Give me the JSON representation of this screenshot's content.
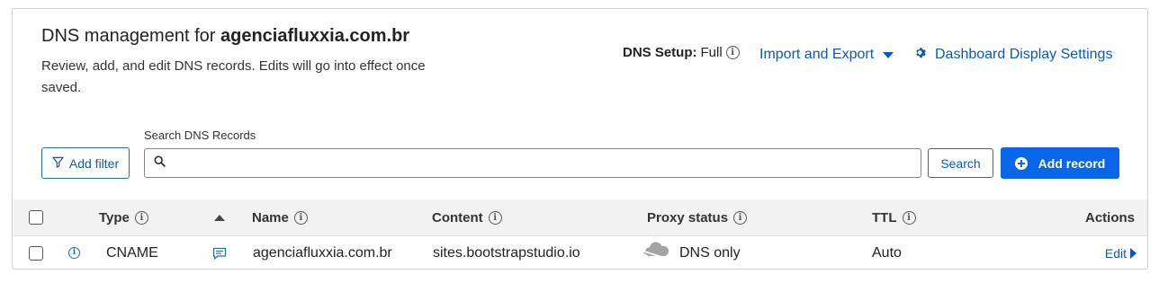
{
  "header": {
    "title_prefix": "DNS management for ",
    "domain": "agenciafluxxia.com.br",
    "subtitle": "Review, add, and edit DNS records. Edits will go into effect once saved.",
    "dns_setup_label": "DNS Setup:",
    "dns_setup_value": "Full",
    "import_export": "Import and Export",
    "dashboard_settings": "Dashboard Display Settings"
  },
  "toolbar": {
    "add_filter": "Add filter",
    "search_label": "Search DNS Records",
    "search_placeholder": "",
    "search_button": "Search",
    "add_record": "Add record"
  },
  "table": {
    "columns": {
      "type": "Type",
      "name": "Name",
      "content": "Content",
      "proxy_status": "Proxy status",
      "ttl": "TTL",
      "actions": "Actions"
    },
    "rows": [
      {
        "type": "CNAME",
        "name": "agenciafluxxia.com.br",
        "content": "sites.bootstrapstudio.io",
        "proxy_status": "DNS only",
        "ttl": "Auto",
        "action": "Edit"
      }
    ]
  },
  "colors": {
    "accent": "#0a66e8",
    "link": "#0a57c2",
    "header_bg": "#f2f2f2"
  }
}
